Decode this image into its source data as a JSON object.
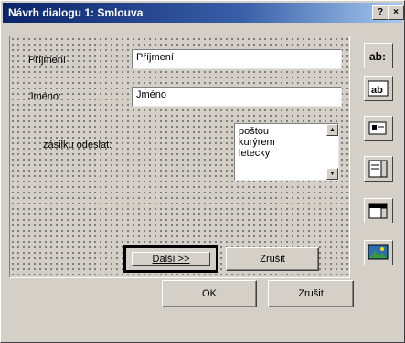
{
  "window": {
    "title": "Návrh dialogu 1: Smlouva",
    "help_label": "?",
    "close_label": "×"
  },
  "form": {
    "surname_label": "Příjmení",
    "surname_value": "Příjmení",
    "firstname_label": "Jméno:",
    "firstname_value": "Jméno",
    "send_label": "zásilku odeslat:",
    "send_options": [
      "poštou",
      "kurýrem",
      "letecky"
    ],
    "next_label": "Další >>",
    "cancel_label": "Zrušit"
  },
  "footer": {
    "ok_label": "OK",
    "cancel_label": "Zrušit"
  },
  "toolbox": {
    "tools": [
      {
        "name": "label-tool-icon",
        "text": "ab:"
      },
      {
        "name": "textbox-tool-icon",
        "text": "ab"
      },
      {
        "name": "checkbox-tool-icon",
        "text": ""
      },
      {
        "name": "listbox-tool-icon",
        "text": ""
      },
      {
        "name": "combobox-tool-icon",
        "text": ""
      },
      {
        "name": "image-tool-icon",
        "text": ""
      }
    ]
  },
  "colors": {
    "titlebar_start": "#0a246a",
    "titlebar_end": "#a6caf0",
    "face": "#d4d0c8"
  }
}
